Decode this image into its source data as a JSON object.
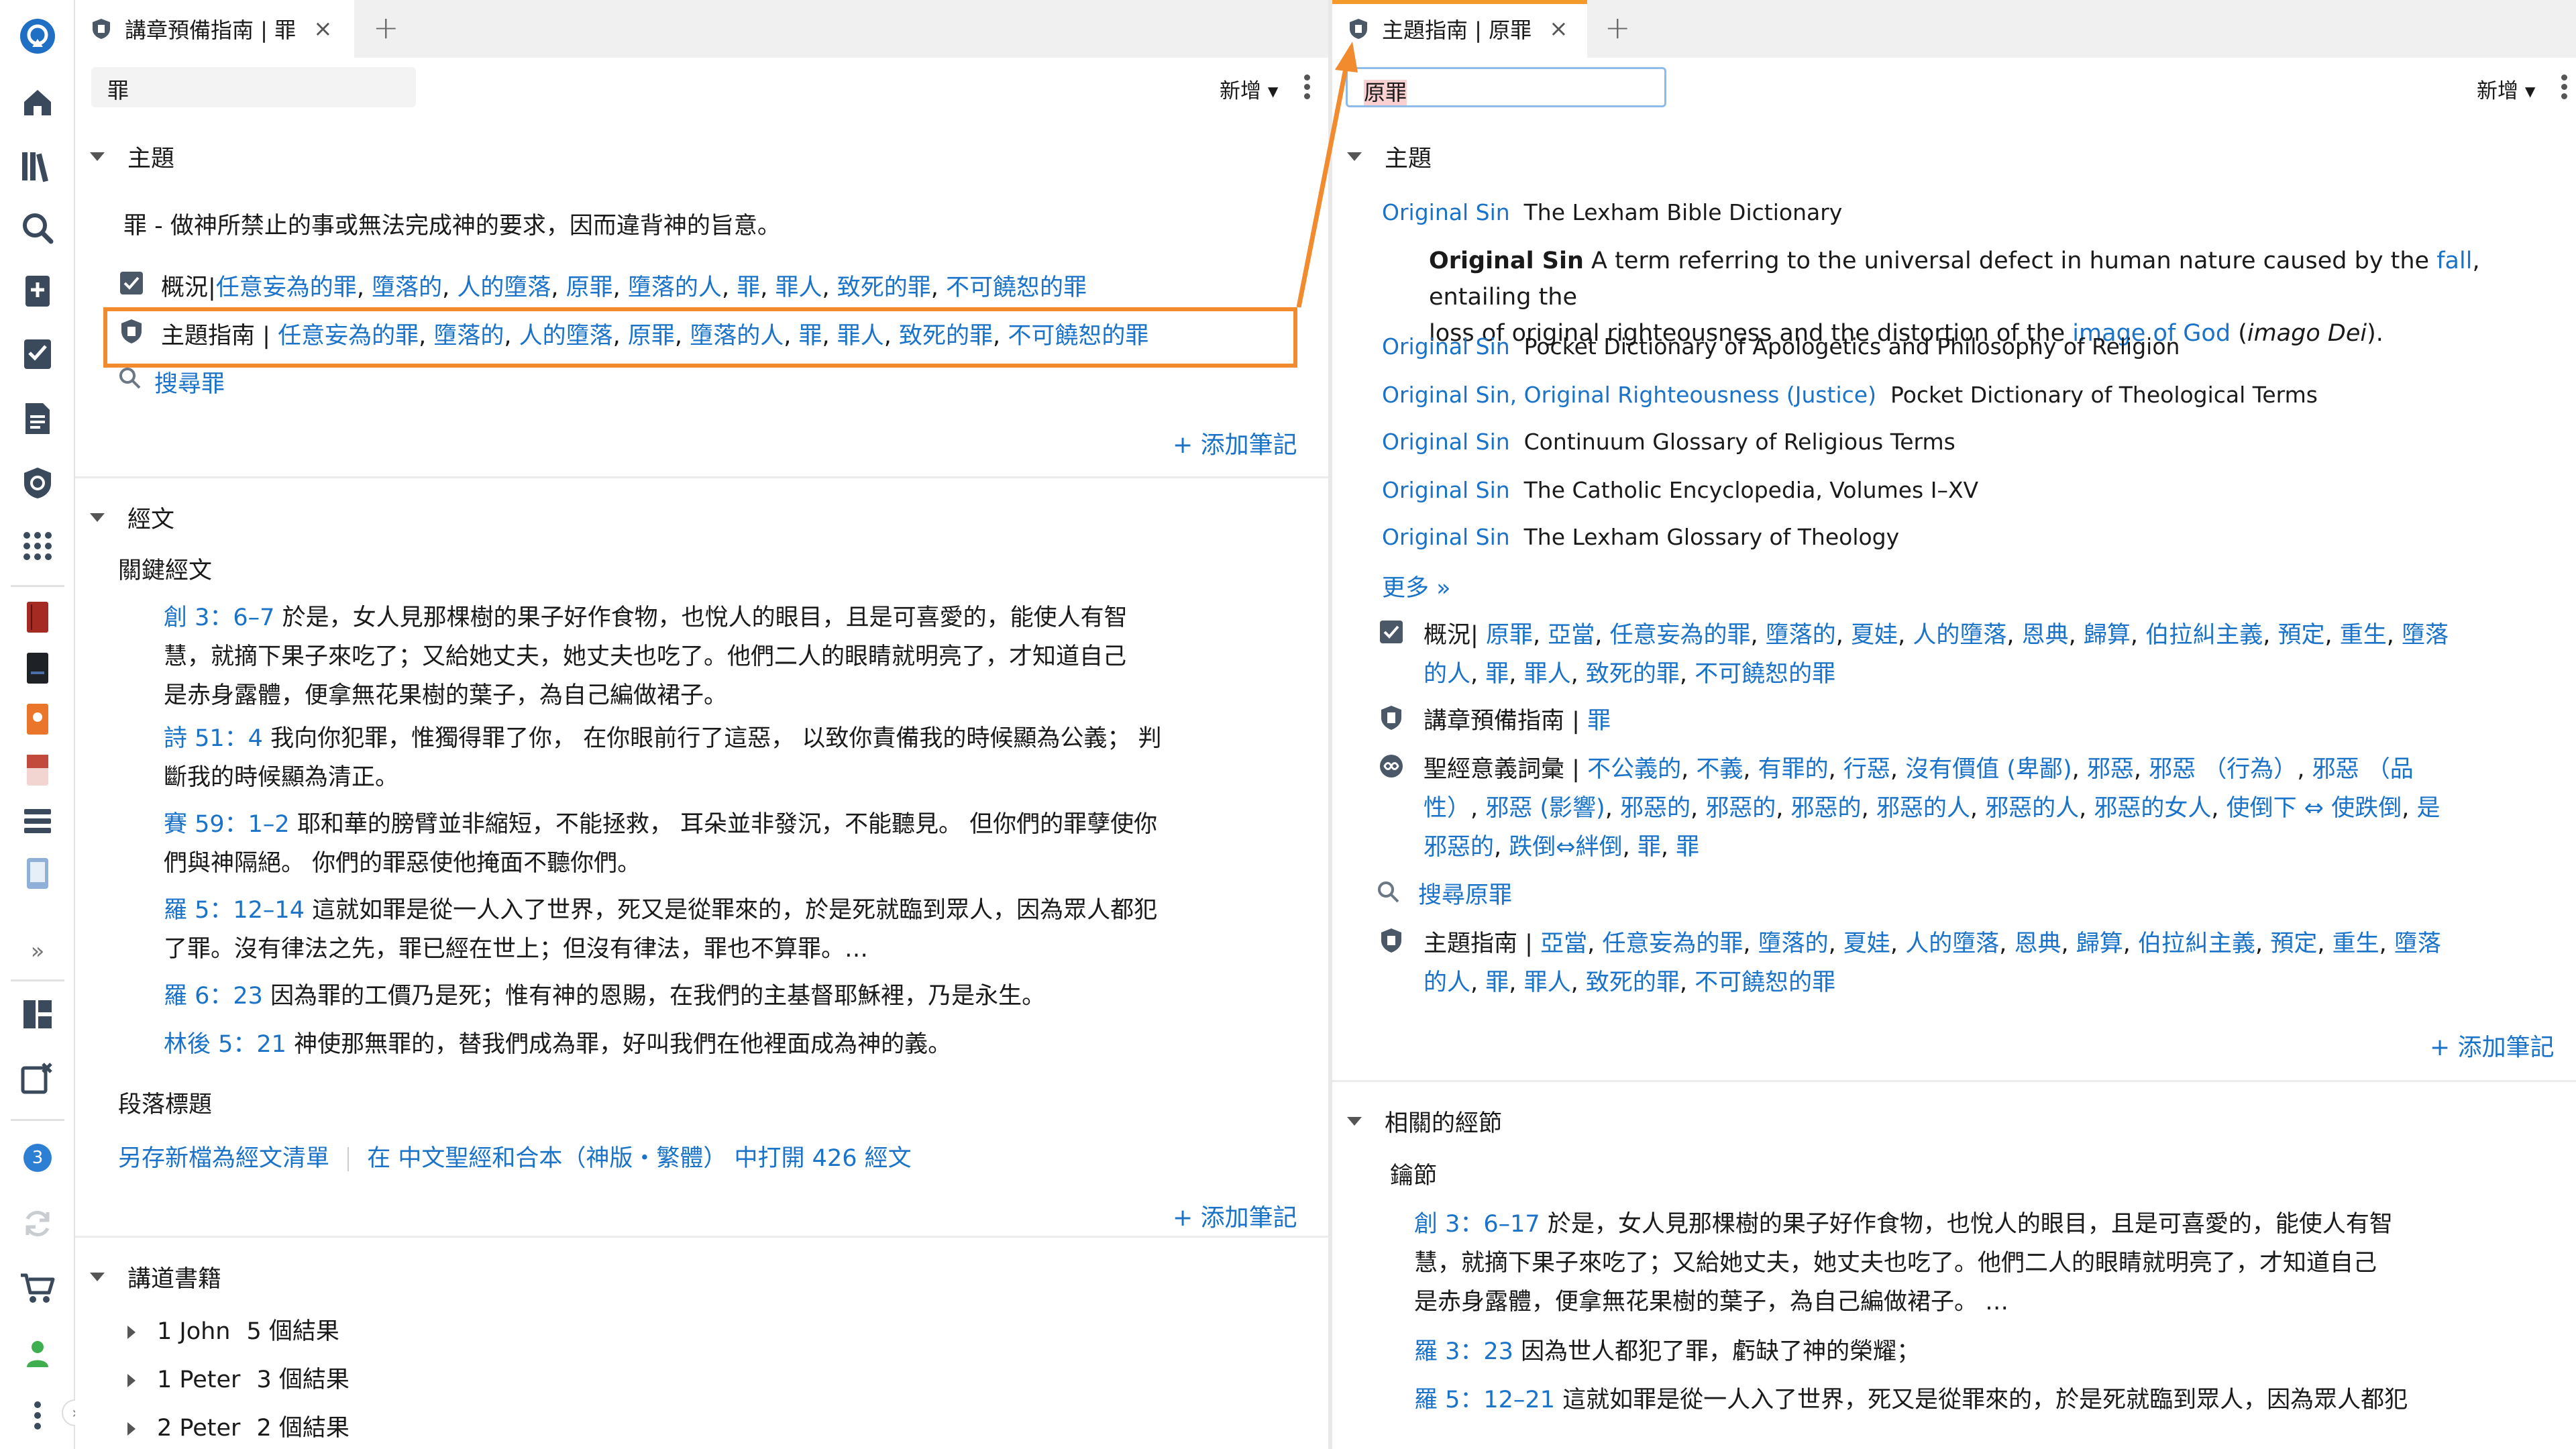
{
  "colors": {
    "link": "#1a73c8",
    "accent": "#f28a2e",
    "active_tab": "#f39a2b",
    "rail_icon": "#3a4a5c"
  },
  "rail": {
    "items": [
      "logos-logo-icon",
      "home-icon",
      "library-icon",
      "search-icon",
      "add-document-icon",
      "checklist-icon",
      "document-icon",
      "guide-shield-icon",
      "apps-grid-icon",
      "book-red-icon",
      "book-black-icon",
      "book-orange-icon",
      "book-pink-icon",
      "stack-icon",
      "device-icon",
      "expand-icon",
      "layout-icon",
      "clear-layout-icon",
      "notifications-badge",
      "sync-icon",
      "cart-icon",
      "user-icon",
      "menu-icon"
    ],
    "badge": "3",
    "expand": "»"
  },
  "left": {
    "tab": {
      "title": "講章預備指南 | 罪",
      "close": "×",
      "add": "+"
    },
    "search_value": "罪",
    "add_menu": "新增 ▾",
    "topic": {
      "heading": "主題",
      "definition": "罪 - 做神所禁止的事或無法完成神的要求，因而違背神的旨意。",
      "overview_label": "概況|",
      "overview_links": [
        "任意妄為的罪",
        "墮落的",
        "人的墮落",
        "原罪",
        "墮落的人",
        "罪",
        "罪人",
        "致死的罪",
        "不可饒恕的罪"
      ],
      "topicguide_label": "主題指南 |",
      "topicguide_links": [
        "任意妄為的罪",
        "墮落的",
        "人的墮落",
        "原罪",
        "墮落的人",
        "罪",
        "罪人",
        "致死的罪",
        "不可饒恕的罪"
      ],
      "search_link": "搜尋罪",
      "add_note": "+ 添加筆記"
    },
    "passages": {
      "heading": "經文",
      "key_heading": "關鍵經文",
      "verses": [
        {
          "ref": "創 3：6–7",
          "text1": " 於是，女人見那棵樹的果子好作食物，也悅人的眼目，且是可喜愛的，能使人有智",
          "text2": "慧，就摘下果子來吃了；又給她丈夫，她丈夫也吃了。他們二人的眼睛就明亮了，才知道自己",
          "text3": "是赤身露體，便拿無花果樹的葉子，為自己編做裙子。"
        },
        {
          "ref": "詩 51：4",
          "text1": " 我向你犯罪，惟獨得罪了你， 在你眼前行了這惡， 以致你責備我的時候顯為公義； 判",
          "text2": "斷我的時候顯為清正。"
        },
        {
          "ref": "賽 59：1–2",
          "text1": " 耶和華的膀臂並非縮短，不能拯救， 耳朵並非發沉，不能聽見。 但你們的罪孽使你",
          "text2": "們與神隔絕。 你們的罪惡使他掩面不聽你們。"
        },
        {
          "ref": "羅 5：12–14",
          "text1": " 這就如罪是從一人入了世界，死又是從罪來的，於是死就臨到眾人，因為眾人都犯",
          "text2": "了罪。沒有律法之先，罪已經在世上；但沒有律法，罪也不算罪。…"
        },
        {
          "ref": "羅 6：23",
          "text1": " 因為罪的工價乃是死；惟有神的恩賜，在我們的主基督耶穌裡，乃是永生。"
        },
        {
          "ref": "林後 5：21",
          "text1": " 神使那無罪的，替我們成為罪，好叫我們在他裡面成為神的義。"
        }
      ],
      "para_heading": "段落標題",
      "save_list": "另存新檔為經文清單",
      "open_in": "在 中文聖經和合本（神版・繁體） 中打開 426 經文",
      "add_note": "+ 添加筆記"
    },
    "sermons": {
      "heading": "講道書籍",
      "items": [
        {
          "book": "1 John",
          "count": "5 個結果"
        },
        {
          "book": "1 Peter",
          "count": "3 個結果"
        },
        {
          "book": "2 Peter",
          "count": "2 個結果"
        }
      ]
    }
  },
  "right": {
    "tab": {
      "title": "主題指南 | 原罪",
      "close": "×",
      "add": "+"
    },
    "search_value": "原罪",
    "add_menu": "新增 ▾",
    "topic": {
      "heading": "主題",
      "entries": [
        {
          "term": "Original Sin",
          "source": "The Lexham Bible Dictionary"
        },
        {
          "term": "Original Sin",
          "source": "Pocket Dictionary of Apologetics and Philosophy of Religion"
        },
        {
          "term": "Original Sin, Original Righteousness (Justice)",
          "source": "Pocket Dictionary of Theological Terms"
        },
        {
          "term": "Original Sin",
          "source": "Continuum Glossary of Religious Terms"
        },
        {
          "term": "Original Sin",
          "source": "The Catholic Encyclopedia, Volumes I–XV"
        },
        {
          "term": "Original Sin",
          "source": "The Lexham Glossary of Theology"
        }
      ],
      "definition": {
        "bold": "Original Sin",
        "t1": " A term referring to the universal defect in human nature caused by the ",
        "link1": "fall",
        "t2": ", entailing the",
        "t3": "loss of original righteousness and the distortion of the ",
        "link2": "image of God",
        "t4": " (",
        "italic": "imago Dei",
        "t5": ")."
      },
      "more": "更多 »",
      "overview_label": "概況|",
      "overview_line1": [
        "原罪",
        "亞當",
        "任意妄為的罪",
        "墮落的",
        "夏娃",
        "人的墮落",
        "恩典",
        "歸算",
        "伯拉糾主義",
        "預定",
        "重生",
        "墮落"
      ],
      "overview_line2": [
        "的人",
        "罪",
        "罪人",
        "致死的罪",
        "不可饒恕的罪"
      ],
      "sermon_label": "講章預備指南 |",
      "sermon_link": "罪",
      "wordstudy_label": "聖經意義詞彙 |",
      "wordstudy_line1": [
        "不公義的",
        "不義",
        "有罪的",
        "行惡",
        "沒有價值 (卑鄙)",
        "邪惡",
        "邪惡 （行為）",
        "邪惡 （品"
      ],
      "wordstudy_line2": [
        "性）",
        "邪惡 (影響)",
        "邪惡的",
        "邪惡的",
        "邪惡的",
        "邪惡的人",
        "邪惡的人",
        "邪惡的女人",
        "使倒下 ⇔ 使跌倒",
        "是"
      ],
      "wordstudy_line3": [
        "邪惡的",
        "跌倒⇔絆倒",
        "罪",
        "罪"
      ],
      "search_link": "搜尋原罪",
      "guide_label": "主題指南 |",
      "guide_line1": [
        "亞當",
        "任意妄為的罪",
        "墮落的",
        "夏娃",
        "人的墮落",
        "恩典",
        "歸算",
        "伯拉糾主義",
        "預定",
        "重生",
        "墮落"
      ],
      "guide_line2": [
        "的人",
        "罪",
        "罪人",
        "致死的罪",
        "不可饒恕的罪"
      ],
      "add_note": "+ 添加筆記"
    },
    "related": {
      "heading": "相關的經節",
      "key_heading": "鑰節",
      "verses": [
        {
          "ref": "創 3：6–17",
          "text1": " 於是，女人見那棵樹的果子好作食物，也悅人的眼目，且是可喜愛的，能使人有智",
          "text2": "慧，就摘下果子來吃了；又給她丈夫，她丈夫也吃了。他們二人的眼睛就明亮了，才知道自己",
          "text3": "是赤身露體，便拿無花果樹的葉子，為自己編做裙子。 …"
        },
        {
          "ref": "羅 3：23",
          "text1": " 因為世人都犯了罪，虧缺了神的榮耀；"
        },
        {
          "ref": "羅 5：12–21",
          "text1": " 這就如罪是從一人入了世界，死又是從罪來的，於是死就臨到眾人，因為眾人都犯"
        }
      ]
    }
  }
}
